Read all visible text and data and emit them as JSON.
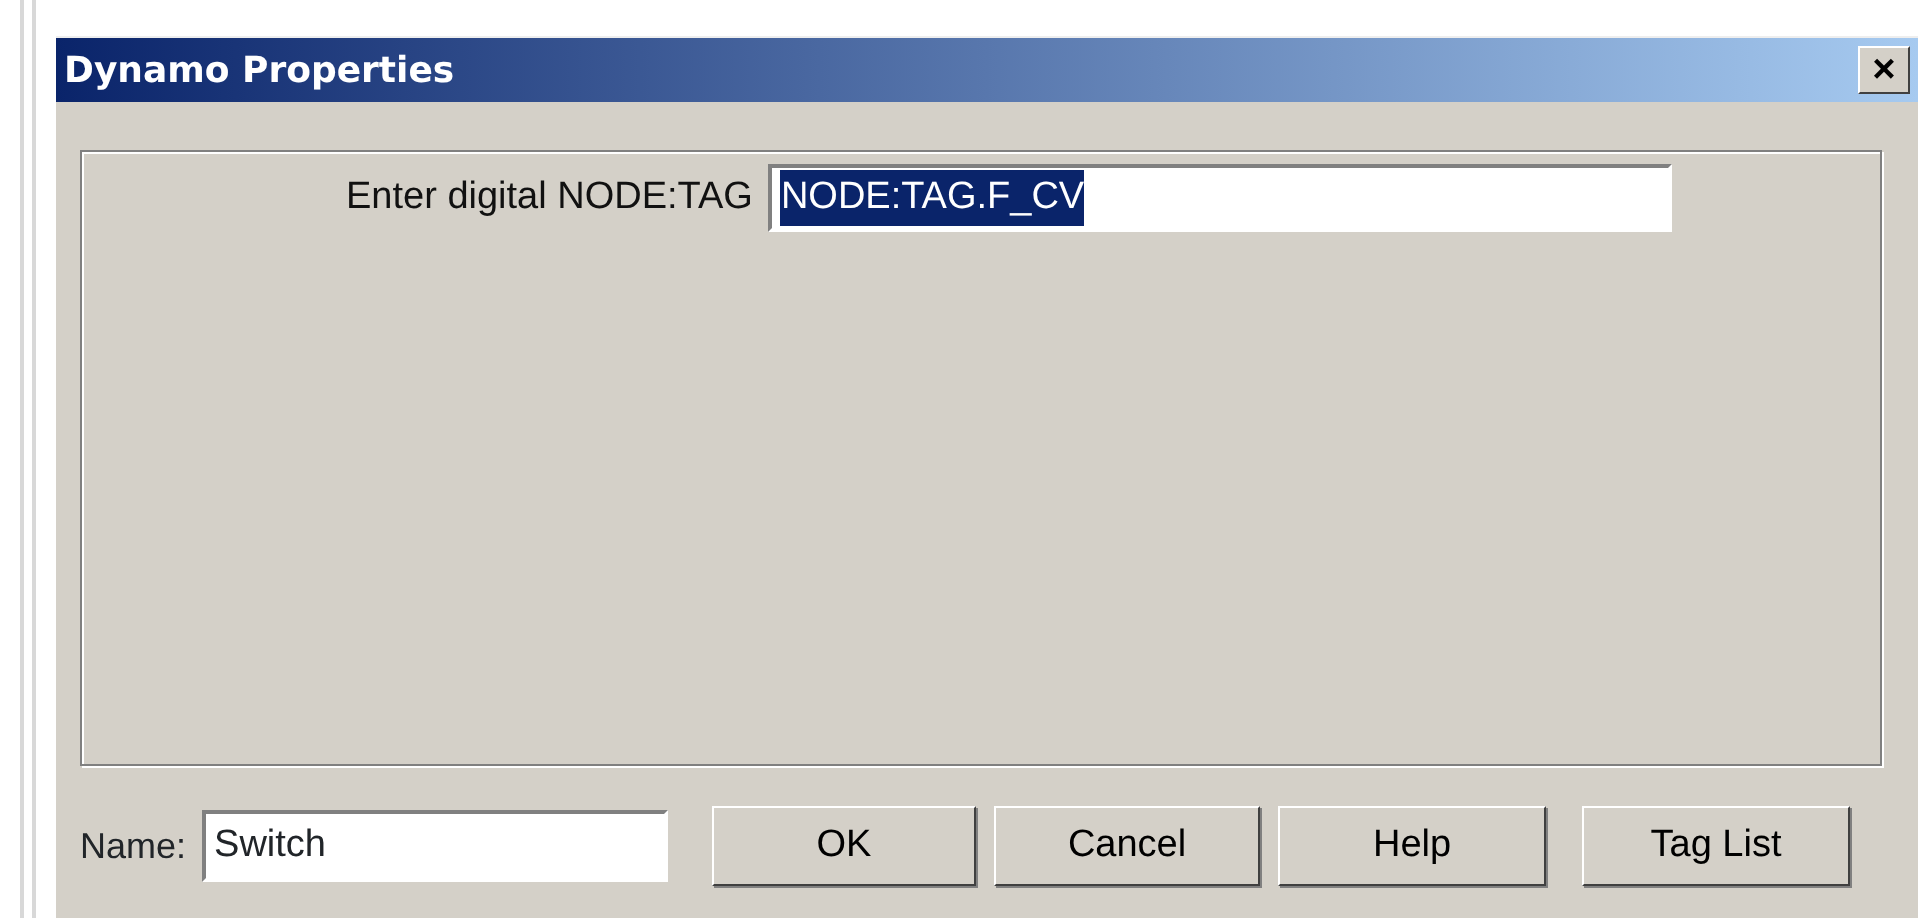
{
  "window": {
    "title": "Dynamo Properties",
    "close": "×"
  },
  "prompt": {
    "label": "Enter digital NODE:TAG",
    "value": "NODE:TAG.F_CV",
    "selected": true
  },
  "name_field": {
    "label": "Name:",
    "value": "Switch"
  },
  "buttons": [
    "OK",
    "Cancel",
    "Help",
    "Tag List"
  ]
}
